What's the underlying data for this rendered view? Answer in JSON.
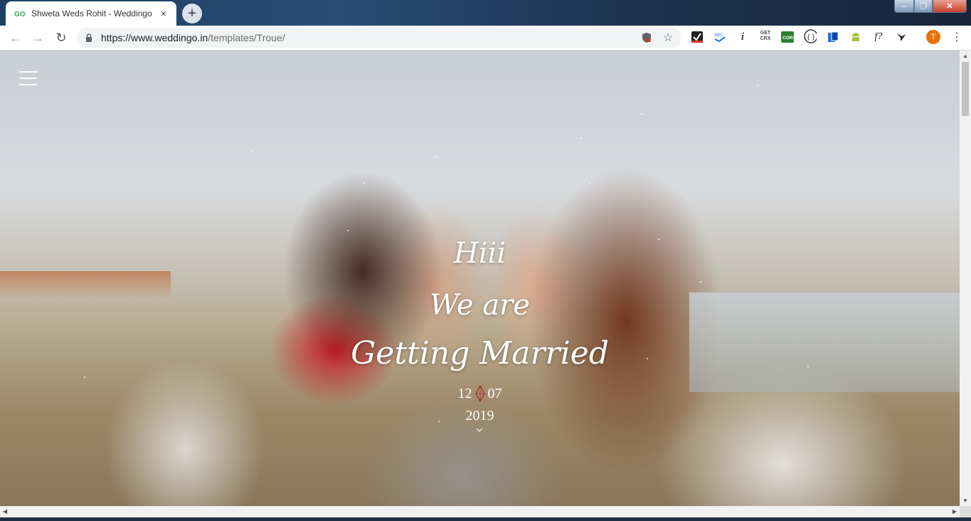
{
  "browser": {
    "tab_title": "Shweta Weds Rohit - Weddingo",
    "tab_close": "×",
    "new_tab": "+",
    "url_host": "https://www.weddingo.in",
    "url_path": "/templates/Troue/",
    "window_controls": {
      "minimize": "–",
      "maximize": "❐",
      "close": "✕"
    },
    "nav": {
      "back": "←",
      "forward": "→",
      "reload": "↻"
    },
    "omnibox_icons": [
      "shield-icon",
      "star-icon"
    ],
    "extensions": [
      {
        "name": "checkmark-ext-icon",
        "text": "✔"
      },
      {
        "name": "spellcheck-ext-icon",
        "text": "ABC"
      },
      {
        "name": "info-ext-icon",
        "text": "i"
      },
      {
        "name": "get-crx-ext-icon",
        "text": "GET CRX"
      },
      {
        "name": "cors-ext-icon",
        "text": "CORS"
      },
      {
        "name": "code-ext-icon",
        "text": "⟨⟩"
      },
      {
        "name": "tablet-ext-icon",
        "text": "▮"
      },
      {
        "name": "android-ext-icon",
        "text": "🤖"
      },
      {
        "name": "font-ext-icon",
        "text": "f?"
      },
      {
        "name": "bird-ext-icon",
        "text": "✈"
      }
    ],
    "profile_initial": "T",
    "menu": "⋮"
  },
  "hero": {
    "line1": "Hiii",
    "line2": "We are",
    "line3": "Getting Married",
    "date_day": "12",
    "date_month": "07",
    "date_year": "2019"
  },
  "colors": {
    "tab_favicon": "#3aa757",
    "profile": "#e8710a",
    "diamond": "#b02a2a"
  }
}
